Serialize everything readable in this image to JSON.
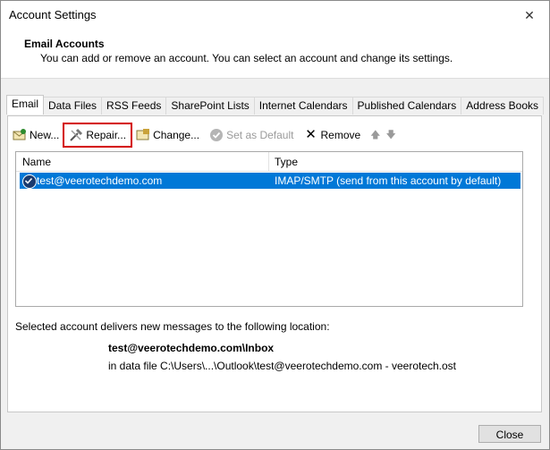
{
  "window": {
    "title": "Account Settings",
    "close_glyph": "✕"
  },
  "header": {
    "title": "Email Accounts",
    "description": "You can add or remove an account. You can select an account and change its settings."
  },
  "tabs": [
    {
      "label": "Email",
      "active": true
    },
    {
      "label": "Data Files"
    },
    {
      "label": "RSS Feeds"
    },
    {
      "label": "SharePoint Lists"
    },
    {
      "label": "Internet Calendars"
    },
    {
      "label": "Published Calendars"
    },
    {
      "label": "Address Books"
    }
  ],
  "toolbar": {
    "new": "New...",
    "repair": "Repair...",
    "change": "Change...",
    "set_default": "Set as Default",
    "remove": "Remove",
    "up_glyph": "🡅",
    "down_glyph": "🡇",
    "remove_glyph": "✕"
  },
  "grid": {
    "columns": [
      "Name",
      "Type"
    ],
    "rows": [
      {
        "name": "test@veerotechdemo.com",
        "type": "IMAP/SMTP (send from this account by default)",
        "selected": true
      }
    ]
  },
  "location": {
    "label": "Selected account delivers new messages to the following location:",
    "path": "test@veerotechdemo.com\\Inbox",
    "file": "in data file C:\\Users\\...\\Outlook\\test@veerotechdemo.com - veerotech.ost"
  },
  "footer": {
    "close": "Close"
  },
  "colors": {
    "selection": "#0078d7",
    "highlight_box": "#d40000"
  }
}
